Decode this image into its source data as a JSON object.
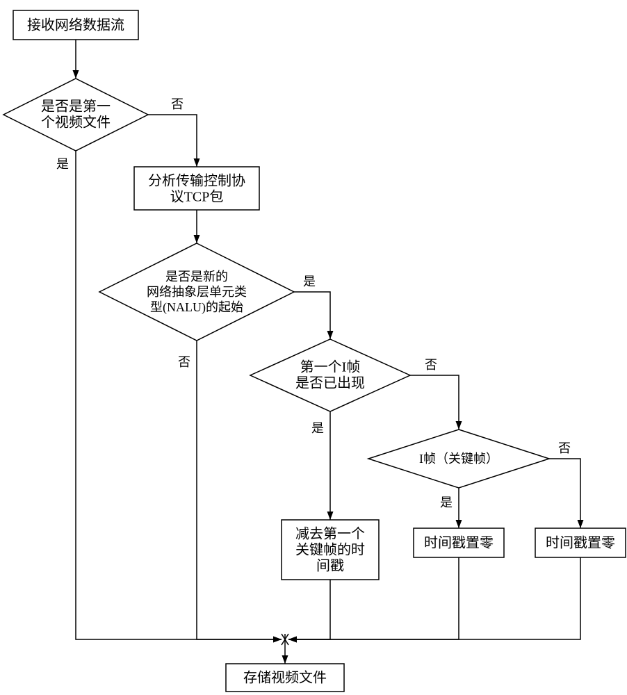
{
  "nodes": {
    "start": "接收网络数据流",
    "d1": [
      "是否是第一",
      "个视频文件"
    ],
    "p1": [
      "分析传输控制协",
      "议TCP包"
    ],
    "d2": [
      "是否是新的",
      "网络抽象层单元类",
      "型(NALU)的起始"
    ],
    "d3": [
      "第一个I帧",
      "是否已出现"
    ],
    "d4": "I帧（关键帧）",
    "p2": [
      "减去第一个",
      "关键帧的时",
      "间戳"
    ],
    "p3": "时间戳置零",
    "p4": "时间戳置零",
    "end": "存储视频文件"
  },
  "edges": {
    "yes": "是",
    "no": "否"
  }
}
